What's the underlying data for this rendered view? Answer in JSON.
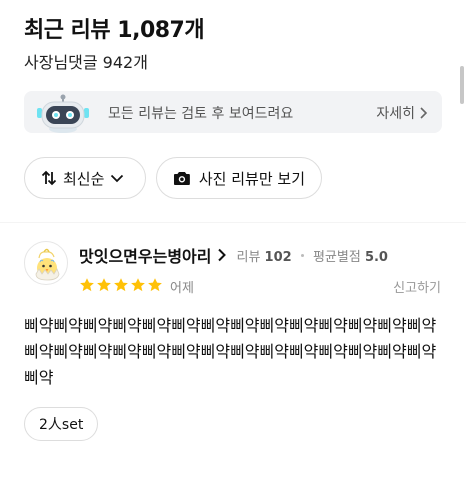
{
  "header": {
    "title": "최근 리뷰 1,087개",
    "subtitle": "사장님댓글 942개"
  },
  "notice": {
    "text": "모든 리뷰는 검토 후 보여드려요",
    "more_label": "자세히",
    "icon": "robot-icon"
  },
  "filters": {
    "sort_label": "최신순",
    "photo_only_label": "사진 리뷰만 보기"
  },
  "review": {
    "nickname": "맛잇으면우는병아리",
    "review_count_label": "리뷰",
    "review_count": "102",
    "avg_rating_label": "평균별점",
    "avg_rating": "5.0",
    "rating": 5,
    "rating_max": 5,
    "date": "어제",
    "report_label": "신고하기",
    "body": "삐약삐약삐약삐약삐약삐약삐약삐약삐약삐약삐약삐약삐약삐약삐약삐약삐약삐약삐약삐약삐약삐약삐약삐약삐약삐약삐약삐약삐약",
    "tags": [
      "2人set"
    ]
  },
  "colors": {
    "star": "#ffc107",
    "notice_bg": "#f2f3f5",
    "robot_face": "#3a4556",
    "robot_glow": "#6fe3f2"
  }
}
